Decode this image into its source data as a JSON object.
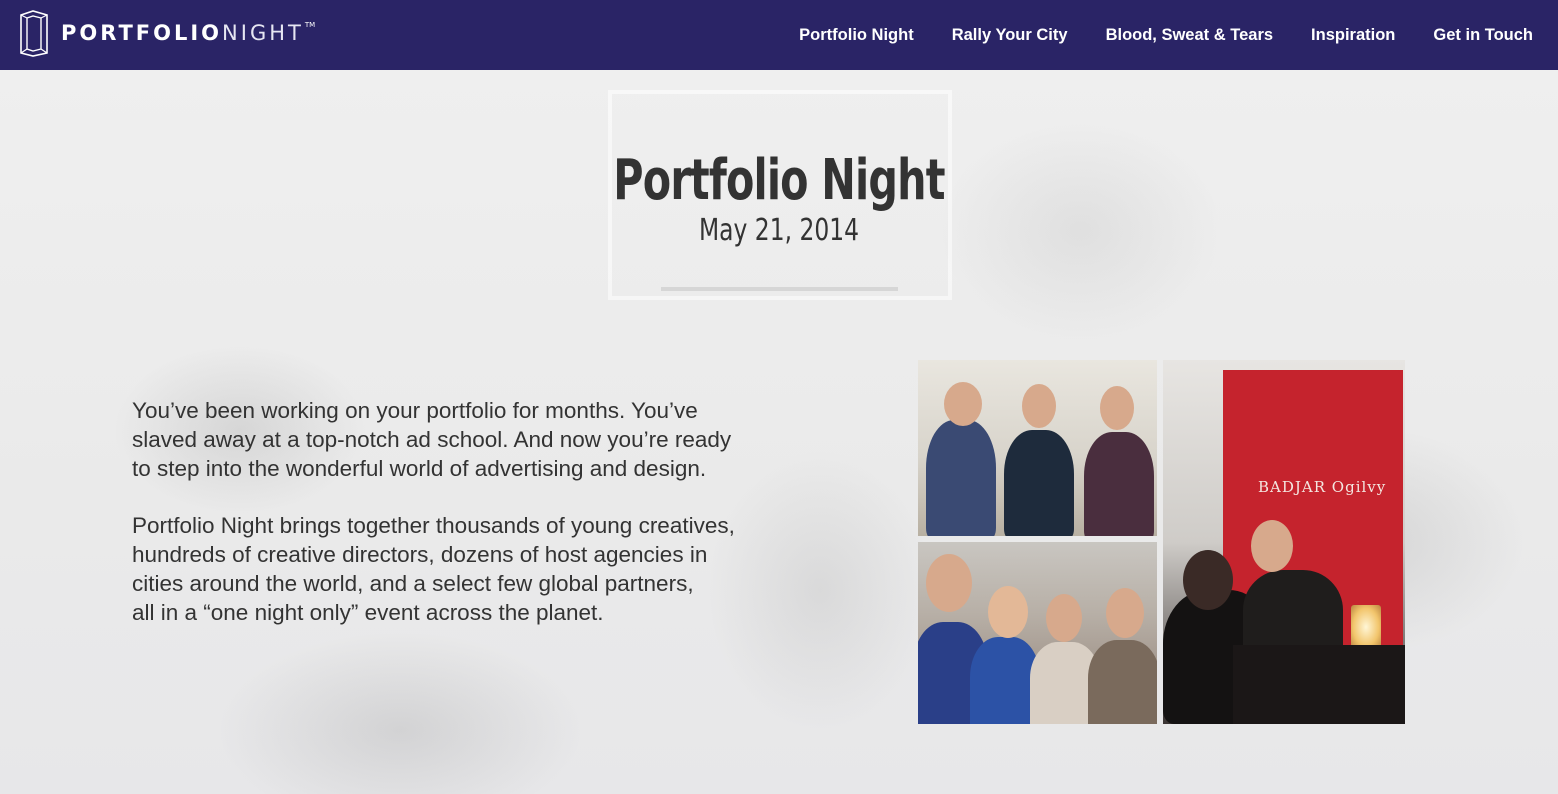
{
  "brand": {
    "logo_primary": "PORTFOLIO",
    "logo_secondary": "NIGHT",
    "trademark": "TM"
  },
  "nav": {
    "items": [
      {
        "label": "Portfolio Night"
      },
      {
        "label": "Rally Your City"
      },
      {
        "label": "Blood, Sweat & Tears"
      },
      {
        "label": "Inspiration"
      },
      {
        "label": "Get in Touch"
      }
    ]
  },
  "hero": {
    "title": "Portfolio Night",
    "date": "May 21, 2014"
  },
  "content": {
    "paragraph_1": "You’ve been working on your portfolio for months. You’ve\nslaved away at a top-notch ad school. And now you’re ready\nto step into the wonderful world of advertising and design.",
    "paragraph_2": "Portfolio Night brings together thousands of young creatives,\nhundreds of creative directors, dozens of host agencies in\ncities around the world, and a select few global partners,\nall in a “one night only” event across the planet."
  },
  "photos": {
    "banner_text": "BADJAR Ogilvy"
  },
  "colors": {
    "header_bg": "#2a2466",
    "nav_text": "#ffffff",
    "body_text": "#333333",
    "banner_red": "#c5232d"
  }
}
